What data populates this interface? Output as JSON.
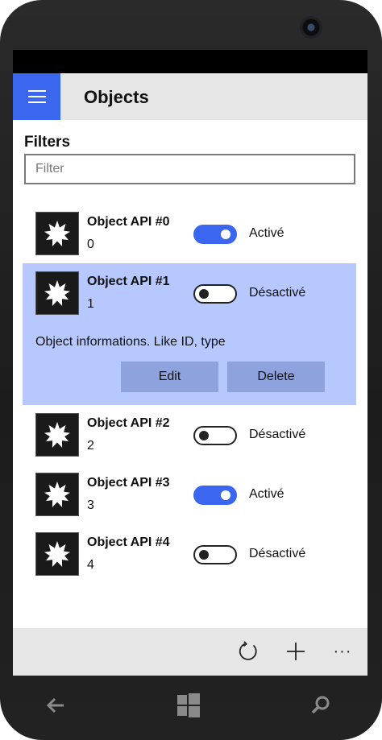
{
  "header": {
    "title": "Objects"
  },
  "filters": {
    "label": "Filters",
    "placeholder": "Filter"
  },
  "items": [
    {
      "name": "Object API #0",
      "id": "0",
      "enabled": true,
      "state": "Activé"
    },
    {
      "name": "Object API #1",
      "id": "1",
      "enabled": false,
      "state": "Désactivé",
      "details": "Object informations. Like ID, type",
      "edit_label": "Edit",
      "delete_label": "Delete"
    },
    {
      "name": "Object API #2",
      "id": "2",
      "enabled": false,
      "state": "Désactivé"
    },
    {
      "name": "Object API #3",
      "id": "3",
      "enabled": true,
      "state": "Activé"
    },
    {
      "name": "Object API #4",
      "id": "4",
      "enabled": false,
      "state": "Désactivé"
    }
  ],
  "appbar": {
    "refresh_icon": "refresh-icon",
    "add_icon": "add-icon",
    "more_label": "···"
  },
  "colors": {
    "accent": "#3a66f0",
    "selected_bg": "#b6c8ff",
    "button_bg": "#8ea3dd",
    "chrome_bg": "#e6e6e6"
  }
}
